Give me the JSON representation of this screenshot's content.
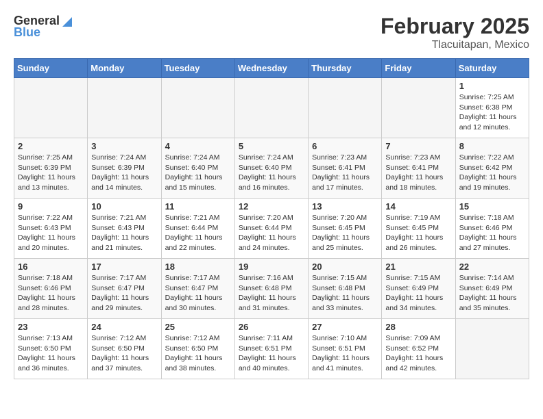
{
  "header": {
    "logo_general": "General",
    "logo_blue": "Blue",
    "month_year": "February 2025",
    "location": "Tlacuitapan, Mexico"
  },
  "weekdays": [
    "Sunday",
    "Monday",
    "Tuesday",
    "Wednesday",
    "Thursday",
    "Friday",
    "Saturday"
  ],
  "weeks": [
    [
      {
        "day": "",
        "info": ""
      },
      {
        "day": "",
        "info": ""
      },
      {
        "day": "",
        "info": ""
      },
      {
        "day": "",
        "info": ""
      },
      {
        "day": "",
        "info": ""
      },
      {
        "day": "",
        "info": ""
      },
      {
        "day": "1",
        "info": "Sunrise: 7:25 AM\nSunset: 6:38 PM\nDaylight: 11 hours\nand 12 minutes."
      }
    ],
    [
      {
        "day": "2",
        "info": "Sunrise: 7:25 AM\nSunset: 6:39 PM\nDaylight: 11 hours\nand 13 minutes."
      },
      {
        "day": "3",
        "info": "Sunrise: 7:24 AM\nSunset: 6:39 PM\nDaylight: 11 hours\nand 14 minutes."
      },
      {
        "day": "4",
        "info": "Sunrise: 7:24 AM\nSunset: 6:40 PM\nDaylight: 11 hours\nand 15 minutes."
      },
      {
        "day": "5",
        "info": "Sunrise: 7:24 AM\nSunset: 6:40 PM\nDaylight: 11 hours\nand 16 minutes."
      },
      {
        "day": "6",
        "info": "Sunrise: 7:23 AM\nSunset: 6:41 PM\nDaylight: 11 hours\nand 17 minutes."
      },
      {
        "day": "7",
        "info": "Sunrise: 7:23 AM\nSunset: 6:41 PM\nDaylight: 11 hours\nand 18 minutes."
      },
      {
        "day": "8",
        "info": "Sunrise: 7:22 AM\nSunset: 6:42 PM\nDaylight: 11 hours\nand 19 minutes."
      }
    ],
    [
      {
        "day": "9",
        "info": "Sunrise: 7:22 AM\nSunset: 6:43 PM\nDaylight: 11 hours\nand 20 minutes."
      },
      {
        "day": "10",
        "info": "Sunrise: 7:21 AM\nSunset: 6:43 PM\nDaylight: 11 hours\nand 21 minutes."
      },
      {
        "day": "11",
        "info": "Sunrise: 7:21 AM\nSunset: 6:44 PM\nDaylight: 11 hours\nand 22 minutes."
      },
      {
        "day": "12",
        "info": "Sunrise: 7:20 AM\nSunset: 6:44 PM\nDaylight: 11 hours\nand 24 minutes."
      },
      {
        "day": "13",
        "info": "Sunrise: 7:20 AM\nSunset: 6:45 PM\nDaylight: 11 hours\nand 25 minutes."
      },
      {
        "day": "14",
        "info": "Sunrise: 7:19 AM\nSunset: 6:45 PM\nDaylight: 11 hours\nand 26 minutes."
      },
      {
        "day": "15",
        "info": "Sunrise: 7:18 AM\nSunset: 6:46 PM\nDaylight: 11 hours\nand 27 minutes."
      }
    ],
    [
      {
        "day": "16",
        "info": "Sunrise: 7:18 AM\nSunset: 6:46 PM\nDaylight: 11 hours\nand 28 minutes."
      },
      {
        "day": "17",
        "info": "Sunrise: 7:17 AM\nSunset: 6:47 PM\nDaylight: 11 hours\nand 29 minutes."
      },
      {
        "day": "18",
        "info": "Sunrise: 7:17 AM\nSunset: 6:47 PM\nDaylight: 11 hours\nand 30 minutes."
      },
      {
        "day": "19",
        "info": "Sunrise: 7:16 AM\nSunset: 6:48 PM\nDaylight: 11 hours\nand 31 minutes."
      },
      {
        "day": "20",
        "info": "Sunrise: 7:15 AM\nSunset: 6:48 PM\nDaylight: 11 hours\nand 33 minutes."
      },
      {
        "day": "21",
        "info": "Sunrise: 7:15 AM\nSunset: 6:49 PM\nDaylight: 11 hours\nand 34 minutes."
      },
      {
        "day": "22",
        "info": "Sunrise: 7:14 AM\nSunset: 6:49 PM\nDaylight: 11 hours\nand 35 minutes."
      }
    ],
    [
      {
        "day": "23",
        "info": "Sunrise: 7:13 AM\nSunset: 6:50 PM\nDaylight: 11 hours\nand 36 minutes."
      },
      {
        "day": "24",
        "info": "Sunrise: 7:12 AM\nSunset: 6:50 PM\nDaylight: 11 hours\nand 37 minutes."
      },
      {
        "day": "25",
        "info": "Sunrise: 7:12 AM\nSunset: 6:50 PM\nDaylight: 11 hours\nand 38 minutes."
      },
      {
        "day": "26",
        "info": "Sunrise: 7:11 AM\nSunset: 6:51 PM\nDaylight: 11 hours\nand 40 minutes."
      },
      {
        "day": "27",
        "info": "Sunrise: 7:10 AM\nSunset: 6:51 PM\nDaylight: 11 hours\nand 41 minutes."
      },
      {
        "day": "28",
        "info": "Sunrise: 7:09 AM\nSunset: 6:52 PM\nDaylight: 11 hours\nand 42 minutes."
      },
      {
        "day": "",
        "info": ""
      }
    ]
  ]
}
